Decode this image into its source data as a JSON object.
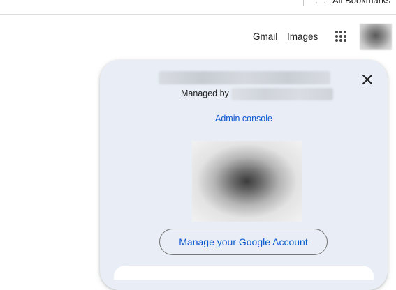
{
  "bookmarks_bar": {
    "all_bookmarks_label": "All Bookmarks"
  },
  "header": {
    "gmail_label": "Gmail",
    "images_label": "Images",
    "apps_icon": "apps-grid-icon"
  },
  "account_panel": {
    "managed_by_label": "Managed by",
    "admin_console_label": "Admin console",
    "manage_account_label": "Manage your Google Account",
    "close_icon": "close-icon"
  },
  "colors": {
    "panel_bg": "#e9eef6",
    "link_blue": "#0b57d0",
    "text": "#1f1f1f",
    "outline": "#747775"
  }
}
